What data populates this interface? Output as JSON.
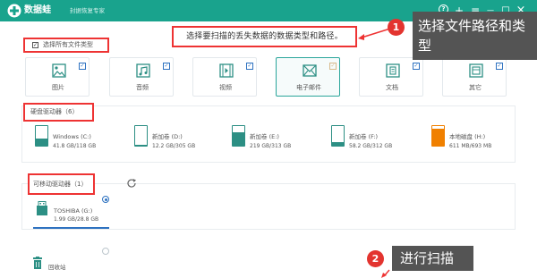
{
  "titlebar": {
    "app_name": "数据蛙",
    "subtitle": "封据恢复专家",
    "icons": [
      "help-icon",
      "plus-icon",
      "menu-icon",
      "minimize-icon",
      "maximize-icon",
      "close-icon"
    ],
    "help_glyph": "?",
    "plus_glyph": "+",
    "menu_glyph": "≡",
    "minimize_glyph": "—",
    "maximize_glyph": "□",
    "close_glyph": "×"
  },
  "banner": {
    "text": "选择要扫描的丢失数据的数据类型和路径。"
  },
  "select_all": {
    "label": "选择所有文件类型",
    "checked": true,
    "check_glyph": "✓"
  },
  "file_types": [
    {
      "label": "图片",
      "icon": "image-icon",
      "checked": true
    },
    {
      "label": "音频",
      "icon": "music-icon",
      "checked": true
    },
    {
      "label": "视频",
      "icon": "video-icon",
      "checked": true
    },
    {
      "label": "电子邮件",
      "icon": "mail-icon",
      "checked": true
    },
    {
      "label": "文档",
      "icon": "document-icon",
      "checked": true
    },
    {
      "label": "其它",
      "icon": "other-icon",
      "checked": true
    }
  ],
  "hdd": {
    "title": "硬盘驱动器（6）",
    "drives": [
      {
        "name": "Windows (C:)",
        "size": "41.8 GB/118 GB",
        "used_fraction": 0.35,
        "color": "#2c8f84"
      },
      {
        "name": "新加卷 (D:)",
        "size": "12.2 GB/305 GB",
        "used_fraction": 0.04,
        "color": "#2c8f84"
      },
      {
        "name": "新加卷 (E:)",
        "size": "219 GB/313 GB",
        "used_fraction": 0.7,
        "color": "#2c8f84"
      },
      {
        "name": "新加卷 (F:)",
        "size": "58.2 GB/312 GB",
        "used_fraction": 0.19,
        "color": "#2c8f84"
      },
      {
        "name": "本地磁盘 (H:)",
        "size": "611 MB/693 MB",
        "used_fraction": 0.88,
        "color": "#f08000"
      }
    ]
  },
  "removable": {
    "title": "可移动驱动器（1）",
    "drive": {
      "name": "TOSHIBA (G:)",
      "size": "1.99 GB/28.8 GB"
    }
  },
  "recycle": {
    "label": "回收站"
  },
  "callouts": [
    {
      "number": "1",
      "text": "选择文件路径和类型"
    },
    {
      "number": "2",
      "text": "进行扫描"
    }
  ],
  "colors": {
    "brand": "#19a38d",
    "highlight": "#e33333",
    "accent": "#2e72c0"
  }
}
